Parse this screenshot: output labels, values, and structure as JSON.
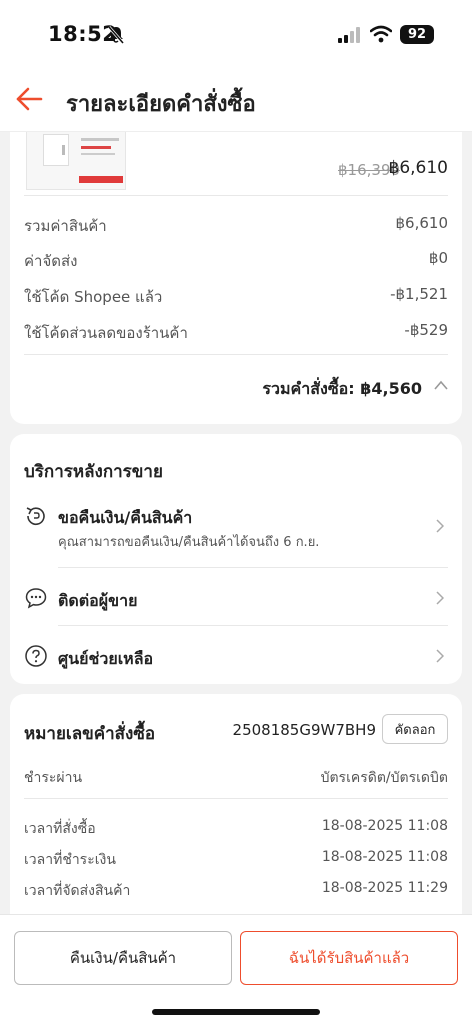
{
  "status": {
    "time": "18:52",
    "battery": "92"
  },
  "header": {
    "title": "รายละเอียดคำสั่งซื้อ"
  },
  "product": {
    "price_original": "฿16,390",
    "price_current": "฿6,610"
  },
  "summary": {
    "rows": [
      {
        "label": "รวมค่าสินค้า",
        "value": "฿6,610"
      },
      {
        "label": "ค่าจัดส่ง",
        "value": "฿0"
      },
      {
        "label": "ใช้โค้ด Shopee แล้ว",
        "value": "-฿1,521"
      },
      {
        "label": "ใช้โค้ดส่วนลดของร้านค้า",
        "value": "-฿529"
      }
    ],
    "total_label": "รวมคำสั่งซื้อ: ฿4,560"
  },
  "service": {
    "title": "บริการหลังการขาย",
    "items": [
      {
        "label": "ขอคืนเงิน/คืนสินค้า",
        "sub": "คุณสามารถขอคืนเงิน/คืนสินค้าได้จนถึง 6 ก.ย."
      },
      {
        "label": "ติดต่อผู้ขาย"
      },
      {
        "label": "ศูนย์ช่วยเหลือ"
      }
    ]
  },
  "order": {
    "title": "หมายเลขคำสั่งซื้อ",
    "number": "2508185G9W7BH9",
    "copy_label": "คัดลอก",
    "payment_label": "ชำระผ่าน",
    "payment_value": "บัตรเครดิต/บัตรเดบิต",
    "times": [
      {
        "label": "เวลาที่สั่งซื้อ",
        "value": "18-08-2025 11:08"
      },
      {
        "label": "เวลาที่ชำระเงิน",
        "value": "18-08-2025 11:08"
      },
      {
        "label": "เวลาที่จัดส่งสินค้า",
        "value": "18-08-2025 11:29"
      }
    ]
  },
  "actions": {
    "return_label": "คืนเงิน/คืนสินค้า",
    "received_label": "ฉันได้รับสินค้าแล้ว"
  },
  "colors": {
    "accent": "#ee4d2d",
    "background": "#f2f2f2"
  }
}
